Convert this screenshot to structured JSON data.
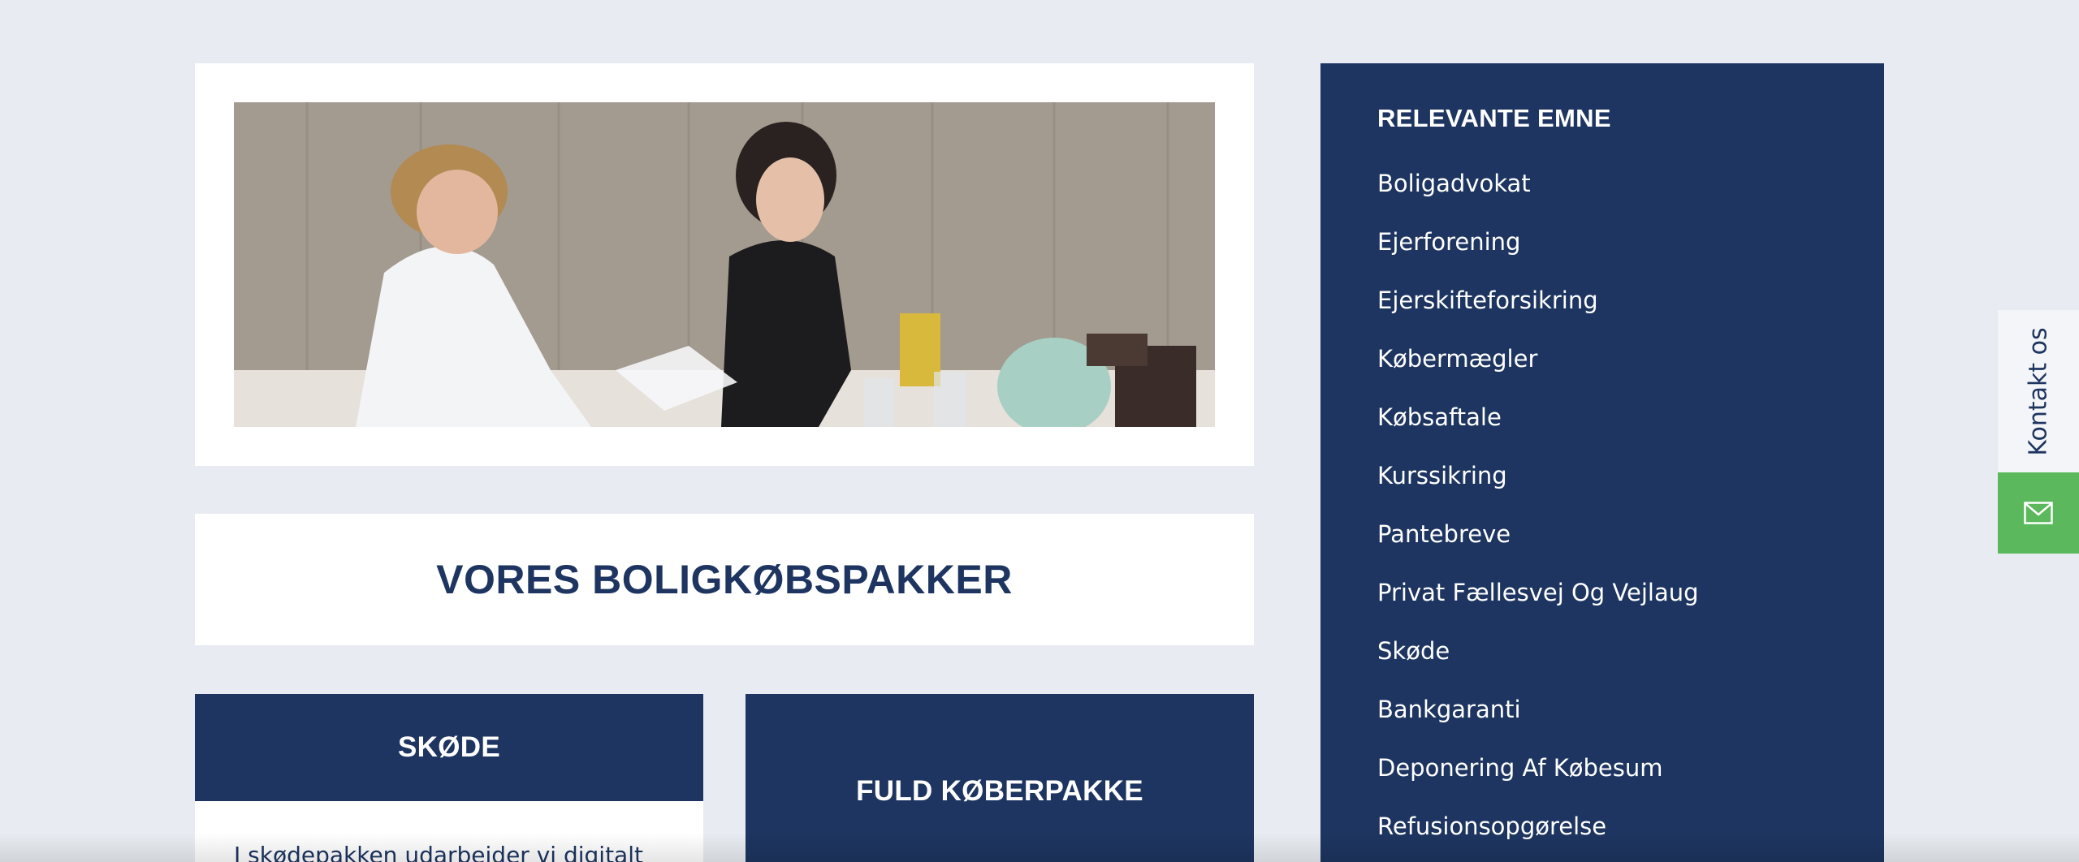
{
  "hero": {
    "image_alt": "Two people reviewing documents at a table"
  },
  "packages_heading": "VORES BOLIGKØBSPAKKER",
  "packages": [
    {
      "title": "SKØDE",
      "text": "I skødepakken udarbejder vi digitalt"
    },
    {
      "title": "FULD KØBERPAKKE"
    }
  ],
  "sidebar": {
    "title": "RELEVANTE EMNE",
    "items": [
      {
        "label": "Boligadvokat"
      },
      {
        "label": "Ejerforening"
      },
      {
        "label": "Ejerskifteforsikring"
      },
      {
        "label": "Købermægler"
      },
      {
        "label": "Købsaftale"
      },
      {
        "label": "Kurssikring"
      },
      {
        "label": "Pantebreve"
      },
      {
        "label": "Privat Fællesvej Og Vejlaug"
      },
      {
        "label": "Skøde"
      },
      {
        "label": "Bankgaranti"
      },
      {
        "label": "Deponering Af Købesum"
      },
      {
        "label": "Refusionsopgørelse"
      }
    ]
  },
  "contact": {
    "label": "Kontakt os",
    "icon": "envelope-icon"
  },
  "colors": {
    "navy": "#1d3560",
    "background": "#e8ebf1",
    "green": "#5cb85c"
  }
}
